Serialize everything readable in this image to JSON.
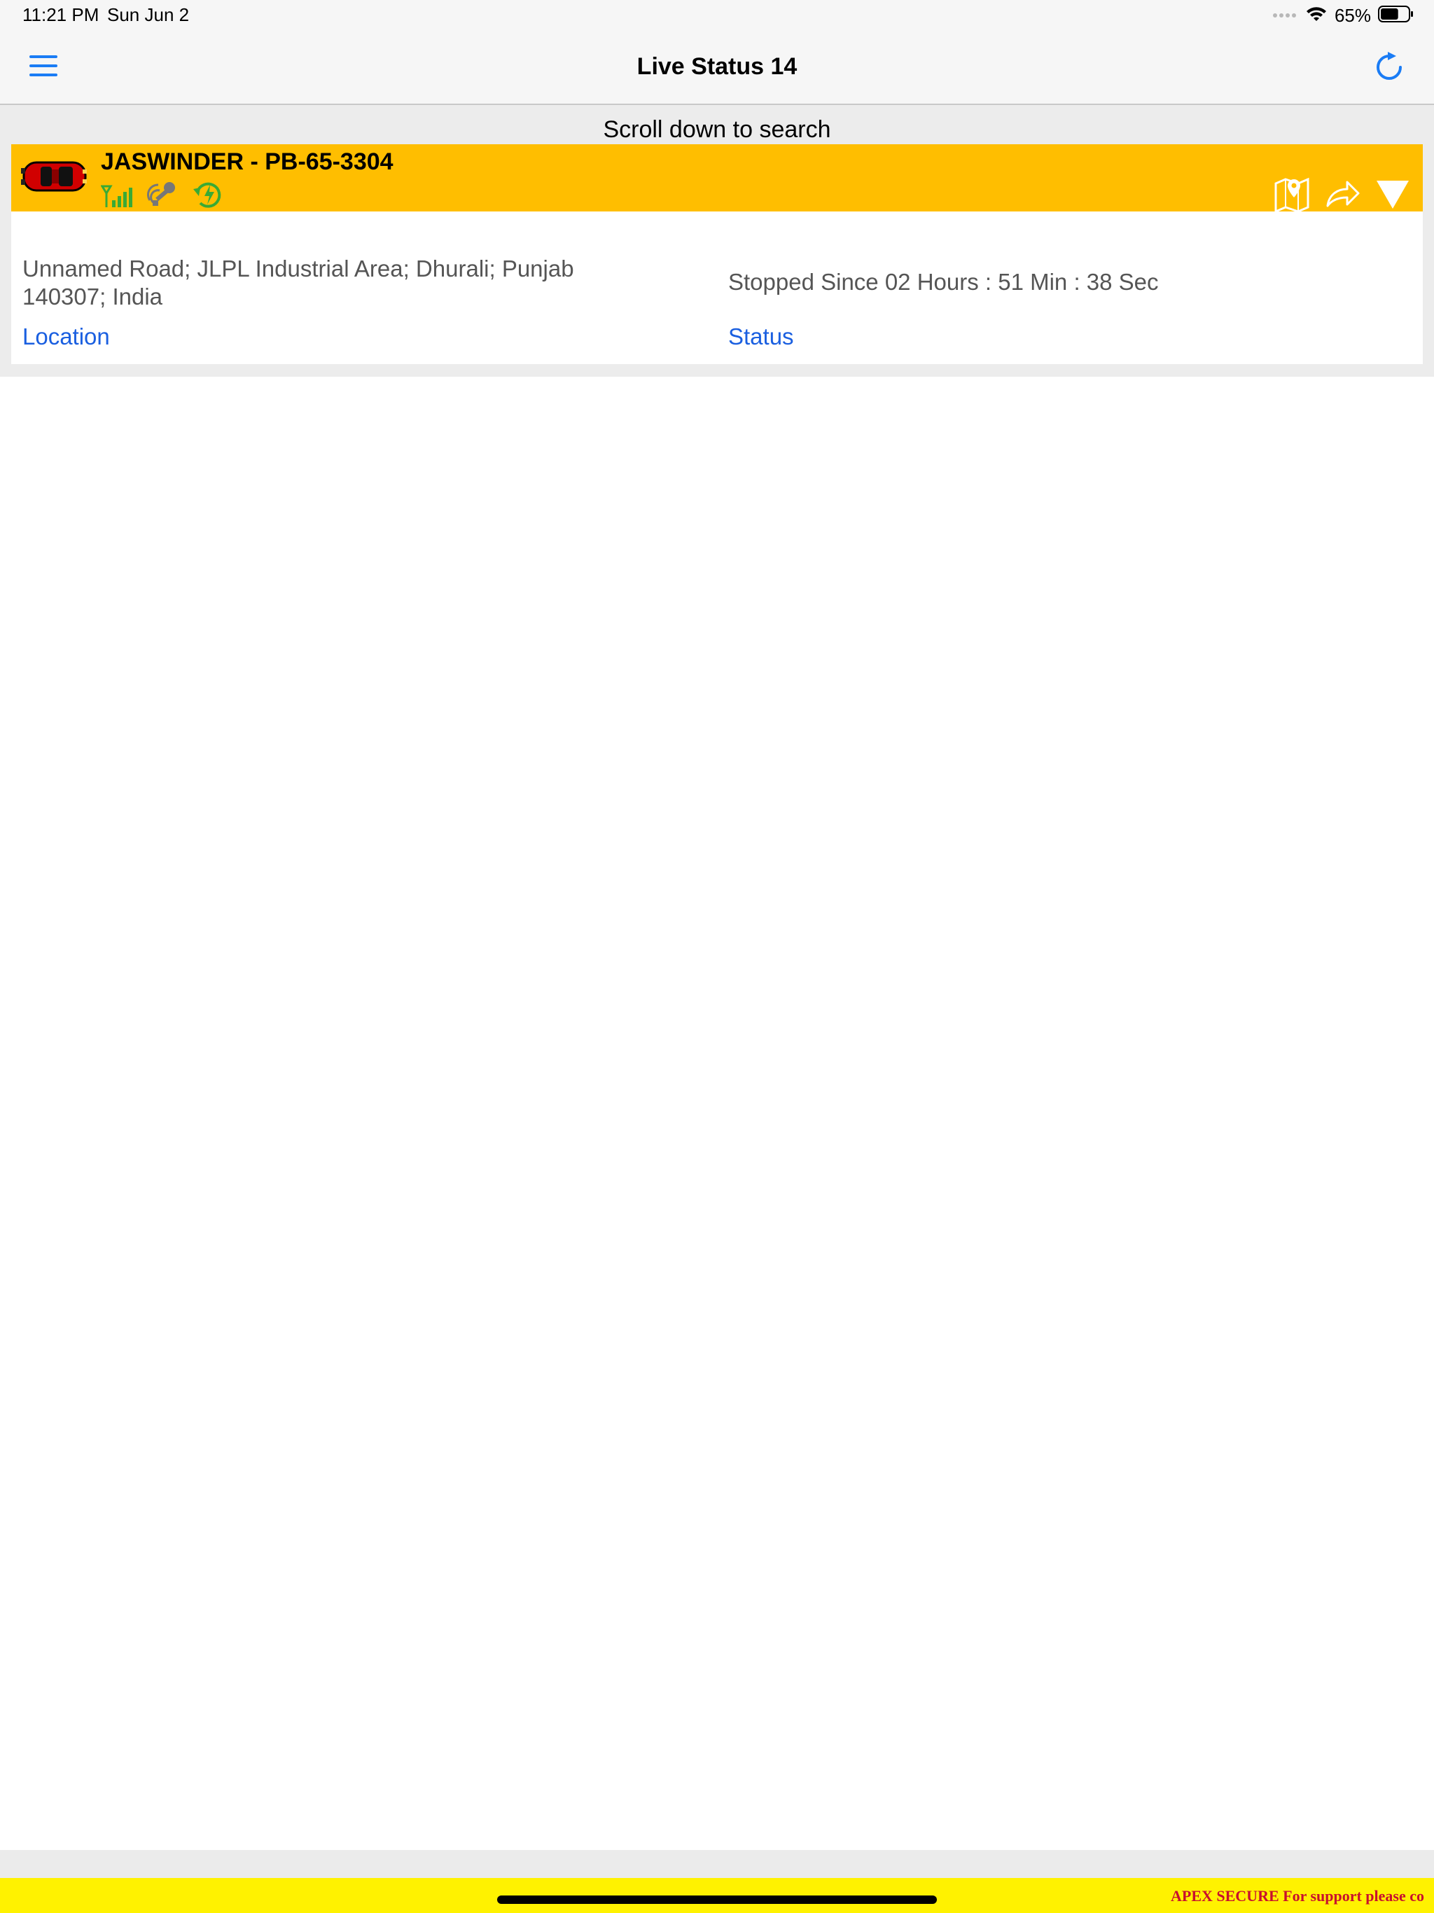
{
  "status_bar": {
    "time": "11:21 PM",
    "date": "Sun Jun 2",
    "battery_percent": "65%",
    "battery_level": 0.65
  },
  "nav": {
    "title": "Live Status 14",
    "menu_icon": "hamburger-menu-icon",
    "refresh_icon": "refresh-icon"
  },
  "search_hint": "Scroll down to search",
  "vehicle": {
    "title": "JASWINDER - PB-65-3304",
    "vehicle_icon": "red-car-icon",
    "status_icons": [
      "gps-signal-icon",
      "ignition-key-icon",
      "power-charge-icon"
    ],
    "actions": [
      "map-pin-icon",
      "share-arrow-icon",
      "expand-triangle-icon"
    ],
    "location_text": "Unnamed Road; JLPL Industrial Area; Dhurali; Punjab 140307; India",
    "location_label": "Location",
    "status_text": "Stopped Since 02 Hours : 51 Min : 38 Sec",
    "status_label": "Status"
  },
  "colors": {
    "header_bg": "#ffbe00",
    "link_blue": "#1a5fe0",
    "accent_blue": "#1a7cf5",
    "footer_yellow": "#fff200",
    "footer_text": "#c8102e",
    "icon_green": "#3aaa35"
  },
  "footer": {
    "marquee": "APEX SECURE For support please co"
  }
}
